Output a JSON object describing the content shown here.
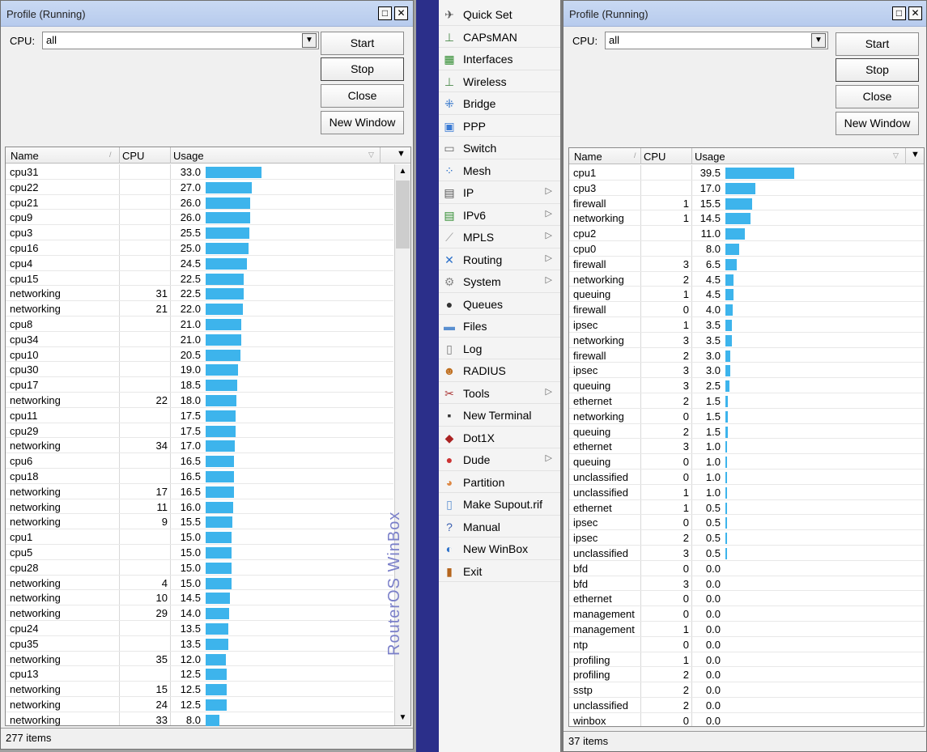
{
  "left_window": {
    "title": "Profile (Running)",
    "cpu_label": "CPU:",
    "cpu_value": "all",
    "buttons": {
      "start": "Start",
      "stop": "Stop",
      "close": "Close",
      "new_window": "New Window"
    },
    "columns": {
      "name": "Name",
      "cpu": "CPU",
      "usage": "Usage"
    },
    "status": "277 items",
    "rows": [
      {
        "name": "cpu31",
        "cpu": "",
        "usage": "33.0",
        "pct": 33.0
      },
      {
        "name": "cpu22",
        "cpu": "",
        "usage": "27.0",
        "pct": 27.0
      },
      {
        "name": "cpu21",
        "cpu": "",
        "usage": "26.0",
        "pct": 26.0
      },
      {
        "name": "cpu9",
        "cpu": "",
        "usage": "26.0",
        "pct": 26.0
      },
      {
        "name": "cpu3",
        "cpu": "",
        "usage": "25.5",
        "pct": 25.5
      },
      {
        "name": "cpu16",
        "cpu": "",
        "usage": "25.0",
        "pct": 25.0
      },
      {
        "name": "cpu4",
        "cpu": "",
        "usage": "24.5",
        "pct": 24.5
      },
      {
        "name": "cpu15",
        "cpu": "",
        "usage": "22.5",
        "pct": 22.5
      },
      {
        "name": "networking",
        "cpu": "31",
        "usage": "22.5",
        "pct": 22.5
      },
      {
        "name": "networking",
        "cpu": "21",
        "usage": "22.0",
        "pct": 22.0
      },
      {
        "name": "cpu8",
        "cpu": "",
        "usage": "21.0",
        "pct": 21.0
      },
      {
        "name": "cpu34",
        "cpu": "",
        "usage": "21.0",
        "pct": 21.0
      },
      {
        "name": "cpu10",
        "cpu": "",
        "usage": "20.5",
        "pct": 20.5
      },
      {
        "name": "cpu30",
        "cpu": "",
        "usage": "19.0",
        "pct": 19.0
      },
      {
        "name": "cpu17",
        "cpu": "",
        "usage": "18.5",
        "pct": 18.5
      },
      {
        "name": "networking",
        "cpu": "22",
        "usage": "18.0",
        "pct": 18.0
      },
      {
        "name": "cpu11",
        "cpu": "",
        "usage": "17.5",
        "pct": 17.5
      },
      {
        "name": "cpu29",
        "cpu": "",
        "usage": "17.5",
        "pct": 17.5
      },
      {
        "name": "networking",
        "cpu": "34",
        "usage": "17.0",
        "pct": 17.0
      },
      {
        "name": "cpu6",
        "cpu": "",
        "usage": "16.5",
        "pct": 16.5
      },
      {
        "name": "cpu18",
        "cpu": "",
        "usage": "16.5",
        "pct": 16.5
      },
      {
        "name": "networking",
        "cpu": "17",
        "usage": "16.5",
        "pct": 16.5
      },
      {
        "name": "networking",
        "cpu": "11",
        "usage": "16.0",
        "pct": 16.0
      },
      {
        "name": "networking",
        "cpu": "9",
        "usage": "15.5",
        "pct": 15.5
      },
      {
        "name": "cpu1",
        "cpu": "",
        "usage": "15.0",
        "pct": 15.0
      },
      {
        "name": "cpu5",
        "cpu": "",
        "usage": "15.0",
        "pct": 15.0
      },
      {
        "name": "cpu28",
        "cpu": "",
        "usage": "15.0",
        "pct": 15.0
      },
      {
        "name": "networking",
        "cpu": "4",
        "usage": "15.0",
        "pct": 15.0
      },
      {
        "name": "networking",
        "cpu": "10",
        "usage": "14.5",
        "pct": 14.5
      },
      {
        "name": "networking",
        "cpu": "29",
        "usage": "14.0",
        "pct": 14.0
      },
      {
        "name": "cpu24",
        "cpu": "",
        "usage": "13.5",
        "pct": 13.5
      },
      {
        "name": "cpu35",
        "cpu": "",
        "usage": "13.5",
        "pct": 13.5
      },
      {
        "name": "networking",
        "cpu": "35",
        "usage": "12.0",
        "pct": 12.0
      },
      {
        "name": "cpu13",
        "cpu": "",
        "usage": "12.5",
        "pct": 12.5
      },
      {
        "name": "networking",
        "cpu": "15",
        "usage": "12.5",
        "pct": 12.5
      },
      {
        "name": "networking",
        "cpu": "24",
        "usage": "12.5",
        "pct": 12.5
      },
      {
        "name": "networking",
        "cpu": "33",
        "usage": "8.0",
        "pct": 8.0
      }
    ]
  },
  "menu": {
    "brand": "RouterOS WinBox",
    "items": [
      {
        "label": "Quick Set",
        "icon": "quick-set-icon",
        "glyph": "✈",
        "color": "#555",
        "sub": false
      },
      {
        "label": "CAPsMAN",
        "icon": "capsman-icon",
        "glyph": "⊥",
        "color": "#4a8a4a",
        "sub": false
      },
      {
        "label": "Interfaces",
        "icon": "interfaces-icon",
        "glyph": "▦",
        "color": "#2d8a2d",
        "sub": false
      },
      {
        "label": "Wireless",
        "icon": "wireless-icon",
        "glyph": "⊥",
        "color": "#4a8a4a",
        "sub": false
      },
      {
        "label": "Bridge",
        "icon": "bridge-icon",
        "glyph": "⁜",
        "color": "#2a6fc9",
        "sub": false
      },
      {
        "label": "PPP",
        "icon": "ppp-icon",
        "glyph": "▣",
        "color": "#3a7bd5",
        "sub": false
      },
      {
        "label": "Switch",
        "icon": "switch-icon",
        "glyph": "▭",
        "color": "#666",
        "sub": false
      },
      {
        "label": "Mesh",
        "icon": "mesh-icon",
        "glyph": "⁘",
        "color": "#2a6fc9",
        "sub": false
      },
      {
        "label": "IP",
        "icon": "ip-icon",
        "glyph": "▤",
        "color": "#555",
        "sub": true
      },
      {
        "label": "IPv6",
        "icon": "ipv6-icon",
        "glyph": "▤",
        "color": "#2d8a2d",
        "sub": true
      },
      {
        "label": "MPLS",
        "icon": "mpls-icon",
        "glyph": "⟋",
        "color": "#999",
        "sub": true
      },
      {
        "label": "Routing",
        "icon": "routing-icon",
        "glyph": "✕",
        "color": "#2a6fc9",
        "sub": true
      },
      {
        "label": "System",
        "icon": "system-icon",
        "glyph": "⚙",
        "color": "#888",
        "sub": true
      },
      {
        "label": "Queues",
        "icon": "queues-icon",
        "glyph": "●",
        "color": "#333",
        "sub": false
      },
      {
        "label": "Files",
        "icon": "files-icon",
        "glyph": "▬",
        "color": "#5a8fd0",
        "sub": false
      },
      {
        "label": "Log",
        "icon": "log-icon",
        "glyph": "▯",
        "color": "#777",
        "sub": false
      },
      {
        "label": "RADIUS",
        "icon": "radius-icon",
        "glyph": "☻",
        "color": "#c07020",
        "sub": false
      },
      {
        "label": "Tools",
        "icon": "tools-icon",
        "glyph": "✂",
        "color": "#a33",
        "sub": true
      },
      {
        "label": "New Terminal",
        "icon": "terminal-icon",
        "glyph": "▪",
        "color": "#333",
        "sub": false
      },
      {
        "label": "Dot1X",
        "icon": "dot1x-icon",
        "glyph": "◆",
        "color": "#a22",
        "sub": false
      },
      {
        "label": "Dude",
        "icon": "dude-icon",
        "glyph": "●",
        "color": "#c33",
        "sub": true
      },
      {
        "label": "Partition",
        "icon": "partition-icon",
        "glyph": "◕",
        "color": "#d84",
        "sub": false
      },
      {
        "label": "Make Supout.rif",
        "icon": "supout-icon",
        "glyph": "▯",
        "color": "#5a8fd0",
        "sub": false
      },
      {
        "label": "Manual",
        "icon": "manual-icon",
        "glyph": "?",
        "color": "#3a5fb0",
        "sub": false
      },
      {
        "label": "New WinBox",
        "icon": "winbox-icon",
        "glyph": "◐",
        "color": "#2a6fc9",
        "sub": false
      },
      {
        "label": "Exit",
        "icon": "exit-icon",
        "glyph": "▮",
        "color": "#b5651d",
        "sub": false
      }
    ]
  },
  "right_window": {
    "title": "Profile (Running)",
    "cpu_label": "CPU:",
    "cpu_value": "all",
    "buttons": {
      "start": "Start",
      "stop": "Stop",
      "close": "Close",
      "new_window": "New Window"
    },
    "columns": {
      "name": "Name",
      "cpu": "CPU",
      "usage": "Usage"
    },
    "status": "37 items",
    "rows": [
      {
        "name": "cpu1",
        "cpu": "",
        "usage": "39.5",
        "pct": 39.5
      },
      {
        "name": "cpu3",
        "cpu": "",
        "usage": "17.0",
        "pct": 17.0
      },
      {
        "name": "firewall",
        "cpu": "1",
        "usage": "15.5",
        "pct": 15.5
      },
      {
        "name": "networking",
        "cpu": "1",
        "usage": "14.5",
        "pct": 14.5
      },
      {
        "name": "cpu2",
        "cpu": "",
        "usage": "11.0",
        "pct": 11.0
      },
      {
        "name": "cpu0",
        "cpu": "",
        "usage": "8.0",
        "pct": 8.0
      },
      {
        "name": "firewall",
        "cpu": "3",
        "usage": "6.5",
        "pct": 6.5
      },
      {
        "name": "networking",
        "cpu": "2",
        "usage": "4.5",
        "pct": 4.5
      },
      {
        "name": "queuing",
        "cpu": "1",
        "usage": "4.5",
        "pct": 4.5
      },
      {
        "name": "firewall",
        "cpu": "0",
        "usage": "4.0",
        "pct": 4.0
      },
      {
        "name": "ipsec",
        "cpu": "1",
        "usage": "3.5",
        "pct": 3.5
      },
      {
        "name": "networking",
        "cpu": "3",
        "usage": "3.5",
        "pct": 3.5
      },
      {
        "name": "firewall",
        "cpu": "2",
        "usage": "3.0",
        "pct": 3.0
      },
      {
        "name": "ipsec",
        "cpu": "3",
        "usage": "3.0",
        "pct": 3.0
      },
      {
        "name": "queuing",
        "cpu": "3",
        "usage": "2.5",
        "pct": 2.5
      },
      {
        "name": "ethernet",
        "cpu": "2",
        "usage": "1.5",
        "pct": 1.5
      },
      {
        "name": "networking",
        "cpu": "0",
        "usage": "1.5",
        "pct": 1.5
      },
      {
        "name": "queuing",
        "cpu": "2",
        "usage": "1.5",
        "pct": 1.5
      },
      {
        "name": "ethernet",
        "cpu": "3",
        "usage": "1.0",
        "pct": 1.0
      },
      {
        "name": "queuing",
        "cpu": "0",
        "usage": "1.0",
        "pct": 1.0
      },
      {
        "name": "unclassified",
        "cpu": "0",
        "usage": "1.0",
        "pct": 1.0
      },
      {
        "name": "unclassified",
        "cpu": "1",
        "usage": "1.0",
        "pct": 1.0
      },
      {
        "name": "ethernet",
        "cpu": "1",
        "usage": "0.5",
        "pct": 0.5
      },
      {
        "name": "ipsec",
        "cpu": "0",
        "usage": "0.5",
        "pct": 0.5
      },
      {
        "name": "ipsec",
        "cpu": "2",
        "usage": "0.5",
        "pct": 0.5
      },
      {
        "name": "unclassified",
        "cpu": "3",
        "usage": "0.5",
        "pct": 0.5
      },
      {
        "name": "bfd",
        "cpu": "0",
        "usage": "0.0",
        "pct": 0.0
      },
      {
        "name": "bfd",
        "cpu": "3",
        "usage": "0.0",
        "pct": 0.0
      },
      {
        "name": "ethernet",
        "cpu": "0",
        "usage": "0.0",
        "pct": 0.0
      },
      {
        "name": "management",
        "cpu": "0",
        "usage": "0.0",
        "pct": 0.0
      },
      {
        "name": "management",
        "cpu": "1",
        "usage": "0.0",
        "pct": 0.0
      },
      {
        "name": "ntp",
        "cpu": "0",
        "usage": "0.0",
        "pct": 0.0
      },
      {
        "name": "profiling",
        "cpu": "1",
        "usage": "0.0",
        "pct": 0.0
      },
      {
        "name": "profiling",
        "cpu": "2",
        "usage": "0.0",
        "pct": 0.0
      },
      {
        "name": "sstp",
        "cpu": "2",
        "usage": "0.0",
        "pct": 0.0
      },
      {
        "name": "unclassified",
        "cpu": "2",
        "usage": "0.0",
        "pct": 0.0
      },
      {
        "name": "winbox",
        "cpu": "0",
        "usage": "0.0",
        "pct": 0.0
      }
    ]
  }
}
